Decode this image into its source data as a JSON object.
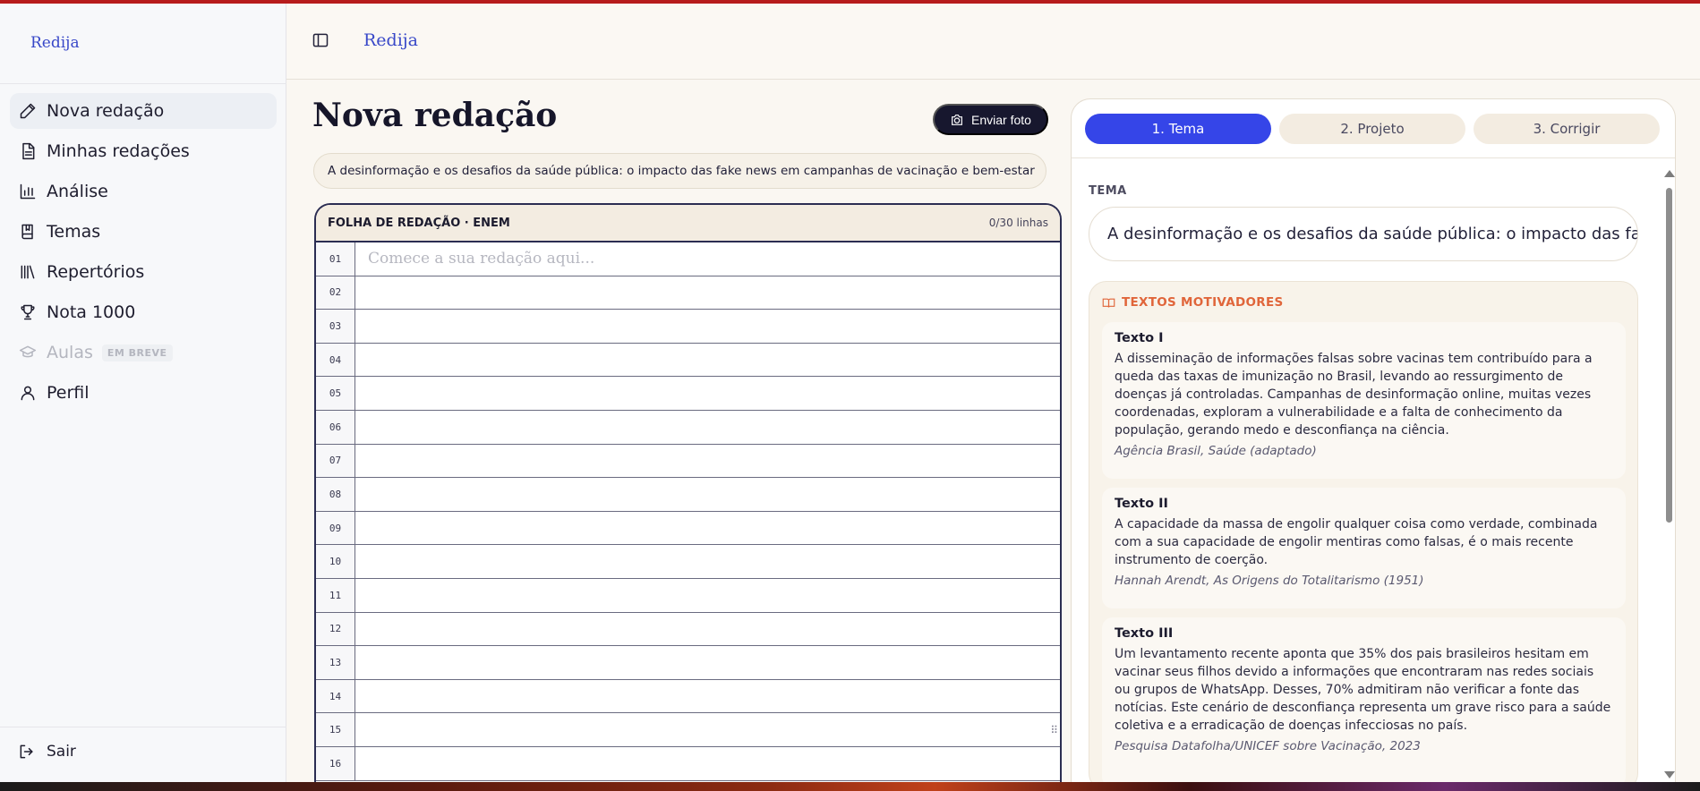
{
  "app": {
    "logo": "Redija"
  },
  "sidebar": {
    "items": [
      {
        "label": "Nova redação",
        "icon": "pencil-icon"
      },
      {
        "label": "Minhas redações",
        "icon": "document-icon"
      },
      {
        "label": "Análise",
        "icon": "bar-chart-icon"
      },
      {
        "label": "Temas",
        "icon": "book-icon"
      },
      {
        "label": "Repertórios",
        "icon": "library-icon"
      },
      {
        "label": "Nota 1000",
        "icon": "trophy-icon"
      },
      {
        "label": "Aulas",
        "icon": "graduation-cap-icon",
        "badge": "EM BREVE"
      },
      {
        "label": "Perfil",
        "icon": "user-icon"
      }
    ],
    "logout_label": "Sair"
  },
  "main": {
    "title": "Nova redação",
    "photo_button": "Enviar foto",
    "theme": "A desinformação e os desafios da saúde pública: o impacto das fake news em campanhas de vacinação e bem-estar",
    "sheet": {
      "title": "FOLHA DE REDAÇÃO · ENEM",
      "count": "0/30 linhas",
      "placeholder": "Comece a sua redação aqui...",
      "lines": [
        "01",
        "02",
        "03",
        "04",
        "05",
        "06",
        "07",
        "08",
        "09",
        "10",
        "11",
        "12",
        "13",
        "14",
        "15",
        "16"
      ]
    }
  },
  "panel": {
    "tabs": [
      "1. Tema",
      "2. Projeto",
      "3. Corrigir"
    ],
    "tema_label": "TEMA",
    "tema_value": "A desinformação e os desafios da saúde pública: o impacto das fake news em campanhas de vacinação e bem-estar",
    "motivadores_label": "TEXTOS MOTIVADORES",
    "texts": [
      {
        "title": "Texto I",
        "body": "A disseminação de informações falsas sobre vacinas tem contribuído para a queda das taxas de imunização no Brasil, levando ao ressurgimento de doenças já controladas. Campanhas de desinformação online, muitas vezes coordenadas, exploram a vulnerabilidade e a falta de conhecimento da população, gerando medo e desconfiança na ciência.",
        "source": "Agência Brasil, Saúde (adaptado)"
      },
      {
        "title": "Texto II",
        "body": "A capacidade da massa de engolir qualquer coisa como verdade, combinada com a sua capacidade de engolir mentiras como falsas, é o mais recente instrumento de coerção.",
        "source": "Hannah Arendt, As Origens do Totalitarismo (1951)"
      },
      {
        "title": "Texto III",
        "body": "Um levantamento recente aponta que 35% dos pais brasileiros hesitam em vacinar seus filhos devido a informações que encontraram nas redes sociais ou grupos de WhatsApp. Desses, 70% admitiram não verificar a fonte das notícias. Este cenário de desconfiança representa um grave risco para a saúde coletiva e a erradicação de doenças infecciosas no país.",
        "source": "Pesquisa Datafolha/UNICEF sobre Vacinação, 2023"
      }
    ]
  },
  "colors": {
    "accent": "#3545e8",
    "brand": "#3848c8",
    "dark": "#17172e",
    "orange": "#e0653a",
    "top_accent": "#b71c1c"
  }
}
